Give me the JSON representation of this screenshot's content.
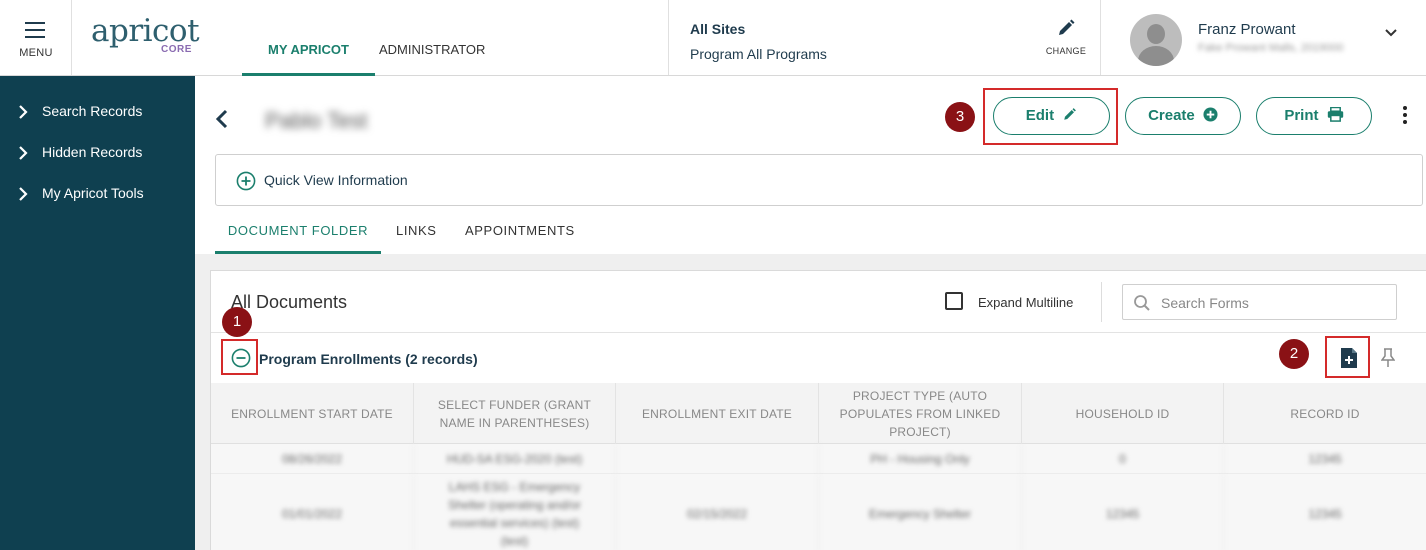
{
  "header": {
    "menu_label": "MENU",
    "logo_word": "apricot",
    "logo_sub": "CORE",
    "nav_tabs": [
      {
        "label": "MY APRICOT",
        "active": true
      },
      {
        "label": "ADMINISTRATOR",
        "active": false
      }
    ],
    "site": {
      "title": "All Sites",
      "program": "Program All Programs",
      "change_label": "CHANGE"
    },
    "user": {
      "name": "Franz Prowant",
      "subtitle": "Fake Prowant Malls, 2019000"
    }
  },
  "sidebar": {
    "items": [
      {
        "label": "Search Records"
      },
      {
        "label": "Hidden Records"
      },
      {
        "label": "My Apricot Tools"
      }
    ]
  },
  "record": {
    "name": "Pablo Test",
    "buttons": {
      "edit": "Edit",
      "create": "Create",
      "print": "Print"
    },
    "quick_view": "Quick View Information",
    "tabs": [
      {
        "label": "DOCUMENT FOLDER",
        "active": true
      },
      {
        "label": "LINKS",
        "active": false
      },
      {
        "label": "APPOINTMENTS",
        "active": false
      }
    ]
  },
  "documents": {
    "title": "All Documents",
    "expand_label": "Expand Multiline",
    "expand_checked": false,
    "search_placeholder": "Search Forms",
    "section_title": "Program Enrollments (2 records)",
    "columns": [
      "ENROLLMENT START DATE",
      "SELECT FUNDER (GRANT NAME IN PARENTHESES)",
      "ENROLLMENT EXIT DATE",
      "PROJECT TYPE (AUTO POPULATES FROM LINKED PROJECT)",
      "HOUSEHOLD ID",
      "RECORD ID"
    ],
    "rows": [
      [
        "08/26/2022",
        "HUD-SA ESG-2020 (test)",
        "",
        "PH - Housing Only",
        "0",
        "12345"
      ],
      [
        "01/01/2022",
        "LAHS ESG - Emergency Shelter (operating and/or essential services) (test) (test)",
        "02/15/2022",
        "Emergency Shelter",
        "12345",
        "12345"
      ]
    ]
  },
  "annotations": {
    "badges": [
      "1",
      "2",
      "3"
    ],
    "badge_color": "#8a1115",
    "box_color": "#d42a2a"
  },
  "colors": {
    "accent": "#1b7f6d",
    "sidebar_bg": "#0f4050",
    "heading": "#1f3b4d"
  }
}
